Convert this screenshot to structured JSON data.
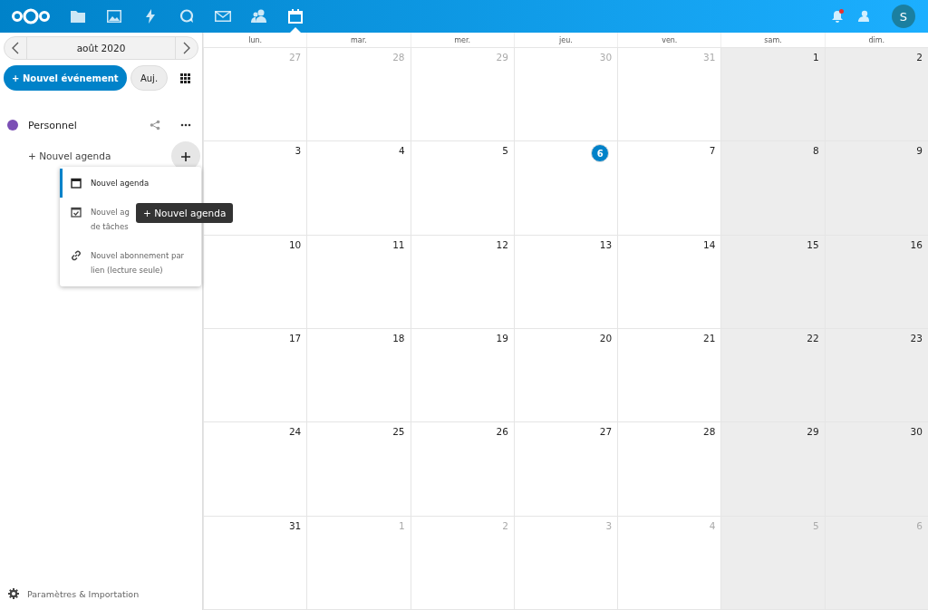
{
  "header": {
    "apps": [
      {
        "kind": "files",
        "selected": false
      },
      {
        "kind": "photos",
        "selected": false
      },
      {
        "kind": "activity",
        "selected": false
      },
      {
        "kind": "talk",
        "selected": false
      },
      {
        "kind": "mail",
        "selected": false
      },
      {
        "kind": "contacts",
        "selected": false
      },
      {
        "kind": "calendar",
        "selected": true
      }
    ],
    "notifications_unread": true,
    "avatar": "S"
  },
  "sidebar": {
    "month": "août 2020",
    "new_event": "+ Nouvel événement",
    "today": "Auj.",
    "calendars": [
      {
        "name": "Personnel",
        "color": "#7b4fb5"
      }
    ],
    "new_calendar": "+ Nouvel agenda",
    "menu": [
      {
        "kind": "calendar",
        "lines": [
          "Nouvel agenda"
        ],
        "selected": true
      },
      {
        "kind": "tasks",
        "lines": [
          "Nouvel ag",
          "de tâches"
        ],
        "selected": false
      },
      {
        "kind": "link",
        "lines": [
          "Nouvel abonnement par",
          "lien (lecture seule)"
        ],
        "selected": false
      }
    ],
    "tooltip": "+ Nouvel agenda",
    "settings": "Paramètres & Importation"
  },
  "calendar": {
    "weekdays": [
      {
        "label": "lun.",
        "weekend": false
      },
      {
        "label": "mar.",
        "weekend": false
      },
      {
        "label": "mer.",
        "weekend": false
      },
      {
        "label": "jeu.",
        "weekend": false
      },
      {
        "label": "ven.",
        "weekend": false
      },
      {
        "label": "sam.",
        "weekend": true
      },
      {
        "label": "dim.",
        "weekend": true
      }
    ],
    "weeks": [
      [
        {
          "day": "27",
          "outside": true,
          "today": false
        },
        {
          "day": "28",
          "outside": true,
          "today": false
        },
        {
          "day": "29",
          "outside": true,
          "today": false
        },
        {
          "day": "30",
          "outside": true,
          "today": false
        },
        {
          "day": "31",
          "outside": true,
          "today": false
        },
        {
          "day": "1",
          "outside": false,
          "today": false
        },
        {
          "day": "2",
          "outside": false,
          "today": false
        }
      ],
      [
        {
          "day": "3",
          "outside": false,
          "today": false
        },
        {
          "day": "4",
          "outside": false,
          "today": false
        },
        {
          "day": "5",
          "outside": false,
          "today": false
        },
        {
          "day": "6",
          "outside": false,
          "today": true
        },
        {
          "day": "7",
          "outside": false,
          "today": false
        },
        {
          "day": "8",
          "outside": false,
          "today": false
        },
        {
          "day": "9",
          "outside": false,
          "today": false
        }
      ],
      [
        {
          "day": "10",
          "outside": false,
          "today": false
        },
        {
          "day": "11",
          "outside": false,
          "today": false
        },
        {
          "day": "12",
          "outside": false,
          "today": false
        },
        {
          "day": "13",
          "outside": false,
          "today": false
        },
        {
          "day": "14",
          "outside": false,
          "today": false
        },
        {
          "day": "15",
          "outside": false,
          "today": false
        },
        {
          "day": "16",
          "outside": false,
          "today": false
        }
      ],
      [
        {
          "day": "17",
          "outside": false,
          "today": false
        },
        {
          "day": "18",
          "outside": false,
          "today": false
        },
        {
          "day": "19",
          "outside": false,
          "today": false
        },
        {
          "day": "20",
          "outside": false,
          "today": false
        },
        {
          "day": "21",
          "outside": false,
          "today": false
        },
        {
          "day": "22",
          "outside": false,
          "today": false
        },
        {
          "day": "23",
          "outside": false,
          "today": false
        }
      ],
      [
        {
          "day": "24",
          "outside": false,
          "today": false
        },
        {
          "day": "25",
          "outside": false,
          "today": false
        },
        {
          "day": "26",
          "outside": false,
          "today": false
        },
        {
          "day": "27",
          "outside": false,
          "today": false
        },
        {
          "day": "28",
          "outside": false,
          "today": false
        },
        {
          "day": "29",
          "outside": false,
          "today": false
        },
        {
          "day": "30",
          "outside": false,
          "today": false
        }
      ],
      [
        {
          "day": "31",
          "outside": false,
          "today": false
        },
        {
          "day": "1",
          "outside": true,
          "today": false
        },
        {
          "day": "2",
          "outside": true,
          "today": false
        },
        {
          "day": "3",
          "outside": true,
          "today": false
        },
        {
          "day": "4",
          "outside": true,
          "today": false
        },
        {
          "day": "5",
          "outside": true,
          "today": false
        },
        {
          "day": "6",
          "outside": true,
          "today": false
        }
      ]
    ]
  }
}
